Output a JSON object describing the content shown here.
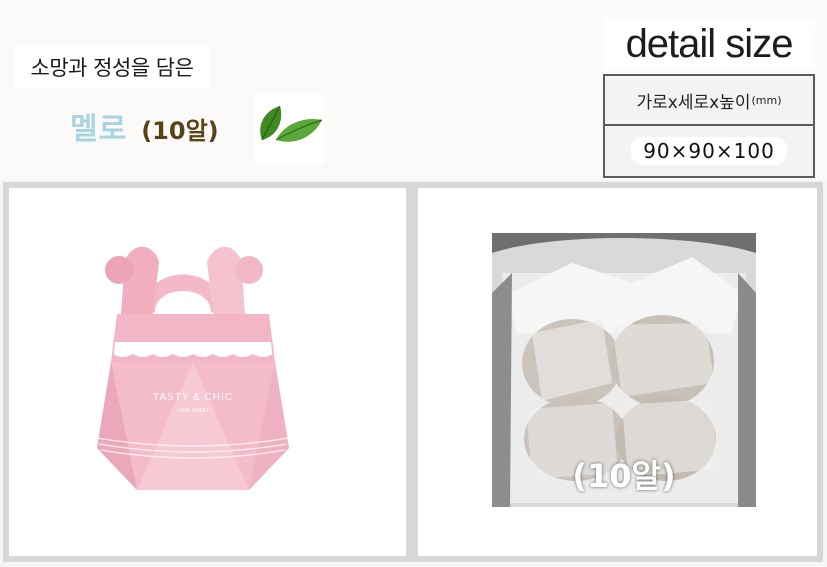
{
  "header": {
    "tagline": "소망과 정성을 담은",
    "product_name": "멜로",
    "product_count": "(10알)"
  },
  "size": {
    "title": "detail size",
    "dimension_label": "가로x세로x높이",
    "unit": "(mm)",
    "value": "90×90×100"
  },
  "box_photo": {
    "brand_text": "TASTY & CHIC",
    "brand_sub": "LOVE SWEET"
  },
  "content_photo": {
    "label": "(10알)"
  },
  "colors": {
    "product_name": "#a9d4e2",
    "product_count": "#5a4218",
    "box_pink": "#f2b6c6",
    "leaf_green": "#4d9a2c"
  },
  "icons": [
    "leaf-icon"
  ]
}
